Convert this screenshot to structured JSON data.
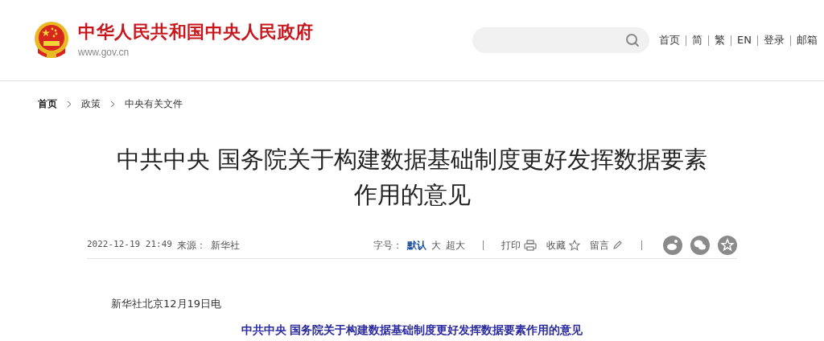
{
  "header": {
    "site_title": "中华人民共和国中央人民政府",
    "site_domain": "www.gov.cn",
    "nav": [
      "首页",
      "简",
      "繁",
      "EN",
      "登录",
      "邮箱"
    ]
  },
  "breadcrumb": [
    {
      "label": "首页",
      "current": true
    },
    {
      "label": "政策",
      "current": false
    },
    {
      "label": "中央有关文件",
      "current": false
    }
  ],
  "article": {
    "title": "中共中央 国务院关于构建数据基础制度更好发挥数据要素作用的意见",
    "datetime": "2022-12-19 21:49",
    "source_label": "来源：",
    "source": "新华社",
    "font_size_label": "字号：",
    "font_sizes": [
      {
        "label": "默认",
        "selected": true
      },
      {
        "label": "大",
        "selected": false
      },
      {
        "label": "超大",
        "selected": false
      }
    ],
    "actions": [
      {
        "kind": "print",
        "label": "打印"
      },
      {
        "kind": "favorite",
        "label": "收藏"
      },
      {
        "kind": "comment",
        "label": "留言"
      }
    ],
    "share": [
      {
        "kind": "weibo"
      },
      {
        "kind": "wechat"
      },
      {
        "kind": "favorite"
      }
    ],
    "dateline": "新华社北京12月19日电",
    "body_title": "中共中央 国务院关于构建数据基础制度更好发挥数据要素作用的意见"
  }
}
